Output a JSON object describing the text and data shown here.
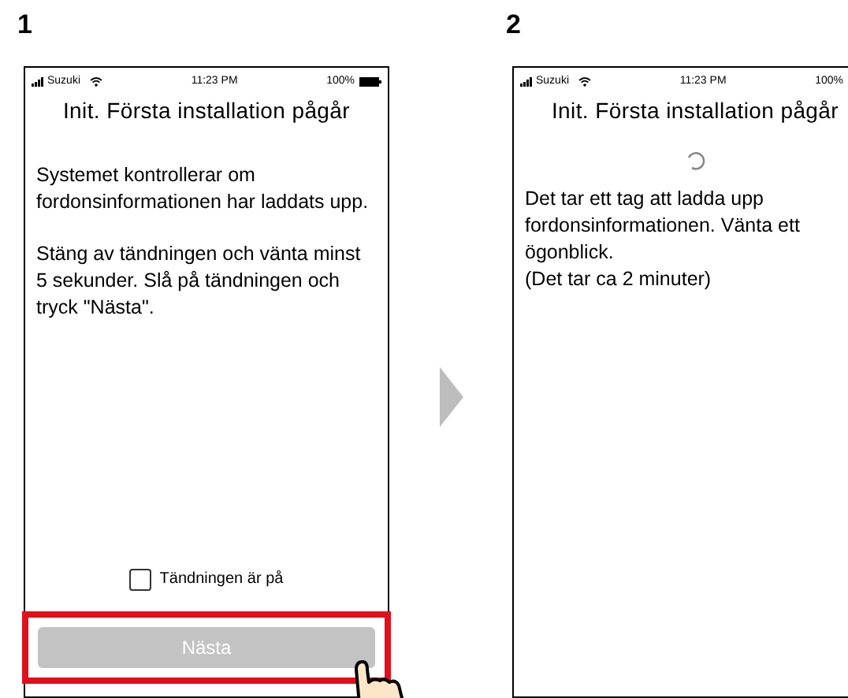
{
  "screens": [
    {
      "number": "1",
      "status_bar": {
        "carrier": "Suzuki",
        "time": "11:23 PM",
        "battery": "100%"
      },
      "title": "Init. Första installation pågår",
      "kind": "instructions",
      "paragraphs": [
        {
          "text": "Systemet kontrollerar om fordonsinformationen har laddats upp."
        },
        {
          "text": "Stäng av tändningen och vänta minst 5 sekunder. Slå på tändningen och tryck \"Nästa\"."
        }
      ],
      "checkbox": {
        "label": "Tändningen är på",
        "checked": false
      },
      "button": {
        "label": "Nästa",
        "disabled": true,
        "highlighted": true
      }
    },
    {
      "number": "2",
      "status_bar": {
        "carrier": "Suzuki",
        "time": "11:23 PM",
        "battery": "100%"
      },
      "title": "Init. Första installation pågår",
      "kind": "loading",
      "paragraphs": [
        {
          "text": "Det tar ett tag att ladda upp fordonsinformationen. Vänta ett ögonblick."
        },
        {
          "text": "(Det tar ca 2 minuter)"
        }
      ]
    }
  ]
}
